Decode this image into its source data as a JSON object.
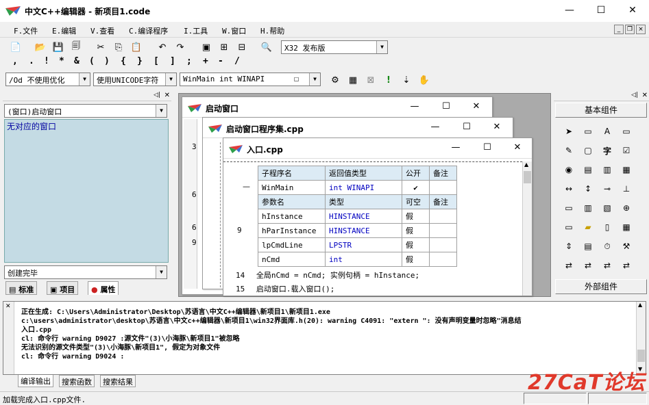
{
  "window": {
    "title": "中文C++编辑器 - 新项目1.code",
    "minimize": "—",
    "maximize": "☐",
    "close": "✕"
  },
  "menu": [
    "F.文件",
    "E.编辑",
    "V.查看",
    "C.编译程序",
    "I.工具",
    "W.窗口",
    "H.帮助"
  ],
  "toolbar": {
    "symbols": [
      ",",
      ".",
      "!",
      "*",
      "&",
      "(",
      ")",
      "{",
      "}",
      "[",
      "]",
      ";",
      "+",
      "-",
      "/"
    ],
    "build_config": "X32 发布版",
    "optimization": "/Od 不使用优化",
    "charset": "使用UNICODE字符",
    "entry": "WinMain int WINAPI"
  },
  "left_panel": {
    "combo": "(窗口)启动窗口",
    "list_item": "无对应的窗口",
    "status_combo": "创建完毕",
    "tabs": [
      "标准",
      "项目",
      "属性"
    ]
  },
  "windows": {
    "w1": {
      "title": "启动窗口",
      "lines": [
        "3",
        "6",
        "6",
        "9"
      ]
    },
    "w2": {
      "title": "启动窗口程序集.cpp"
    },
    "w3": {
      "title": "入口.cpp",
      "table_header1": [
        "子程序名",
        "返回值类型",
        "公开",
        "备注"
      ],
      "func_row": [
        "WinMain",
        "int WINAPI",
        "✔",
        ""
      ],
      "table_header2": [
        "参数名",
        "类型",
        "可空",
        "备注"
      ],
      "params": [
        [
          "hInstance",
          "HINSTANCE",
          "假",
          ""
        ],
        [
          "hParInstance",
          "HINSTANCE",
          "假",
          ""
        ],
        [
          "lpCmdLine",
          "LPSTR",
          "假",
          ""
        ],
        [
          "nCmd",
          "int",
          "假",
          ""
        ]
      ],
      "gutter_line": "9",
      "code": [
        {
          "num": "14",
          "text": "全局nCmd = nCmd; 实例句柄 = hInstance;"
        },
        {
          "num": "15",
          "text": "启动窗口.载入窗口();"
        }
      ]
    }
  },
  "right_panel": {
    "header": "基本组件",
    "footer": "外部组件"
  },
  "output": {
    "lines": [
      "正在生成: C:\\Users\\Administrator\\Desktop\\苏语言\\中文C++编辑器\\新项目1\\新项目1.exe",
      "c:\\users\\administrator\\desktop\\苏语言\\中文c++编辑器\\新项目1\\win32界面库.h(20): warning C4091: \"extern \": 没有声明变量时忽略\"消息结",
      "入口.cpp",
      "cl: 命令行 warning D9027 :源文件\"(3)\\小海豚\\新项目1\"被忽略",
      "无法识别的源文件类型\"(3)\\小海豚\\新项目1\", 假定为对象文件",
      "cl: 命令行 warning D9024 :"
    ],
    "tabs": [
      "编译输出",
      "搜索函数",
      "搜索结果"
    ]
  },
  "status": "加载完成入口.cpp文件.",
  "watermark": "27CaT论坛",
  "colors": {
    "list_bg": "#c4dbe4",
    "header_cell": "#dcebf5",
    "keyword": "#0000c0",
    "watermark": "#e0392b"
  }
}
